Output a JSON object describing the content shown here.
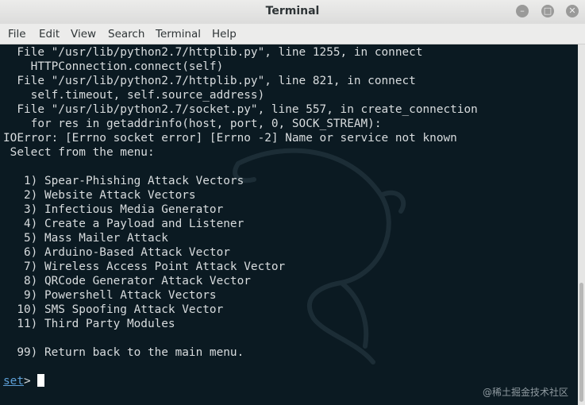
{
  "window": {
    "title": "Terminal"
  },
  "menubar": {
    "items": [
      "File",
      "Edit",
      "View",
      "Search",
      "Terminal",
      "Help"
    ]
  },
  "terminal": {
    "lines": [
      "  File \"/usr/lib/python2.7/httplib.py\", line 1255, in connect",
      "    HTTPConnection.connect(self)",
      "  File \"/usr/lib/python2.7/httplib.py\", line 821, in connect",
      "    self.timeout, self.source_address)",
      "  File \"/usr/lib/python2.7/socket.py\", line 557, in create_connection",
      "    for res in getaddrinfo(host, port, 0, SOCK_STREAM):",
      "IOError: [Errno socket error] [Errno -2] Name or service not known",
      " Select from the menu:",
      "",
      "   1) Spear-Phishing Attack Vectors",
      "   2) Website Attack Vectors",
      "   3) Infectious Media Generator",
      "   4) Create a Payload and Listener",
      "   5) Mass Mailer Attack",
      "   6) Arduino-Based Attack Vector",
      "   7) Wireless Access Point Attack Vector",
      "   8) QRCode Generator Attack Vector",
      "   9) Powershell Attack Vectors",
      "  10) SMS Spoofing Attack Vector",
      "  11) Third Party Modules",
      "",
      "  99) Return back to the main menu.",
      ""
    ],
    "prompt_label": "set",
    "prompt_suffix": "> "
  },
  "watermark": "@稀土掘金技术社区",
  "colors": {
    "terminal_bg": "#0b1a22",
    "text": "#d8dcde",
    "prompt": "#5d9fd6"
  }
}
